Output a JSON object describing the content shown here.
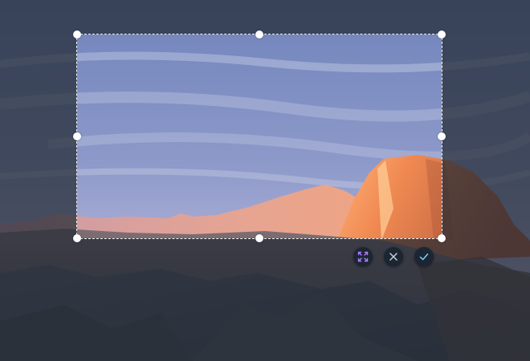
{
  "editor": {
    "mode": "crop",
    "selection_handles": [
      "top-left",
      "top",
      "top-right",
      "left",
      "right",
      "bottom-left",
      "bottom",
      "bottom-right"
    ]
  },
  "toolbar": {
    "buttons": [
      {
        "id": "fullscreen",
        "icon": "expand-corners-icon",
        "color": "#b07bff"
      },
      {
        "id": "cancel",
        "icon": "close-icon",
        "color": "#c9d1da"
      },
      {
        "id": "confirm",
        "icon": "check-icon",
        "color": "#7fd0f7"
      }
    ]
  },
  "colors": {
    "overlay": "#222a33",
    "button_bg": "#1c2633",
    "selection_border": "#ffffff"
  }
}
